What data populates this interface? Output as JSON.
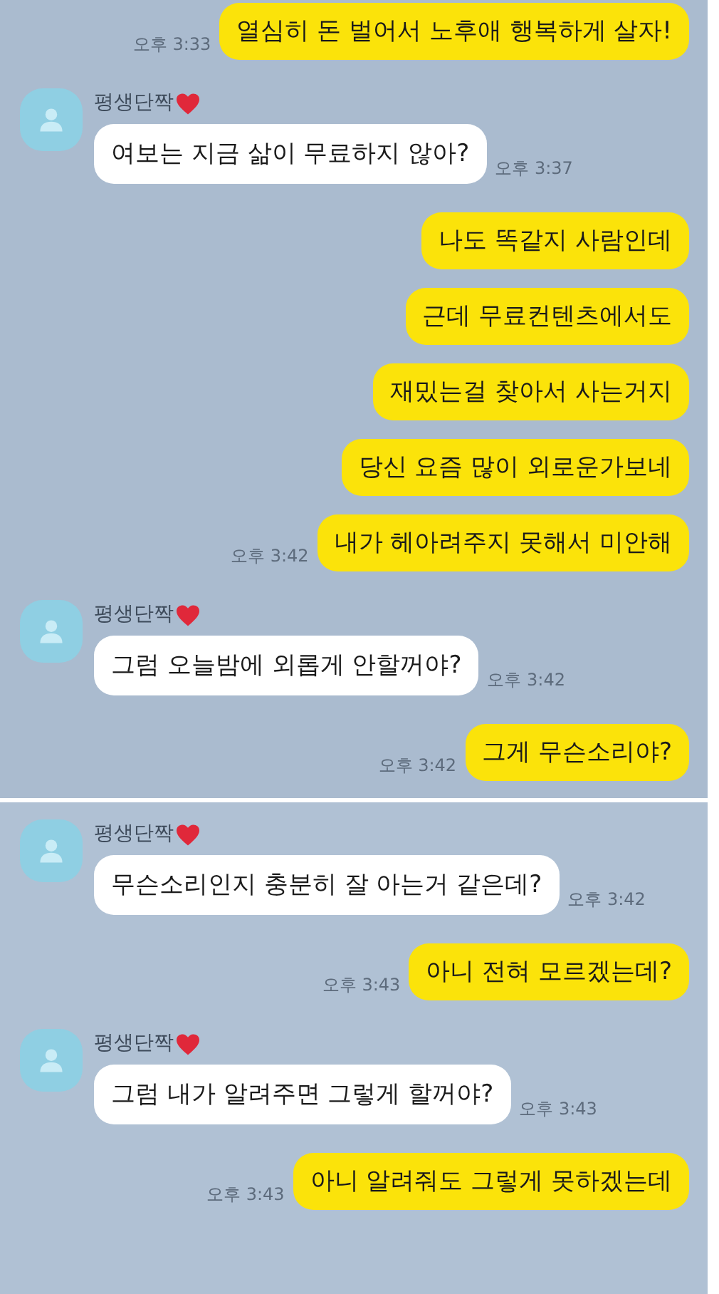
{
  "panels": [
    {
      "messages": [
        {
          "kind": "sent",
          "text": "열심히 돈 벌어서 노후애 행복하게 살자!",
          "time": "오후 3:33"
        },
        {
          "kind": "received",
          "sender": "평생단짝",
          "text": "여보는 지금 삶이 무료하지 않아?",
          "time": "오후 3:37"
        },
        {
          "kind": "sent",
          "text": "나도 똑같지 사람인데"
        },
        {
          "kind": "sent",
          "text": "근데 무료컨텐츠에서도"
        },
        {
          "kind": "sent",
          "text": "재밌는걸 찾아서 사는거지"
        },
        {
          "kind": "sent",
          "text": "당신 요즘 많이 외로운가보네"
        },
        {
          "kind": "sent",
          "text": "내가 헤아려주지 못해서 미안해",
          "time": "오후 3:42"
        },
        {
          "kind": "received",
          "sender": "평생단짝",
          "text": "그럼 오늘밤에 외롭게 안할꺼야?",
          "time": "오후 3:42"
        },
        {
          "kind": "sent",
          "text": "그게 무슨소리야?",
          "time": "오후 3:42"
        }
      ]
    },
    {
      "messages": [
        {
          "kind": "received",
          "sender": "평생단짝",
          "text": "무슨소리인지 충분히 잘 아는거 같은데?",
          "time": "오후 3:42"
        },
        {
          "kind": "sent",
          "text": "아니 전혀 모르겠는데?",
          "time": "오후 3:43"
        },
        {
          "kind": "received",
          "sender": "평생단짝",
          "text": "그럼 내가 알려주면 그렇게 할꺼야?",
          "time": "오후 3:43"
        },
        {
          "kind": "sent",
          "text": "아니 알려줘도 그렇게 못하겠는데",
          "time": "오후 3:43"
        }
      ]
    }
  ]
}
